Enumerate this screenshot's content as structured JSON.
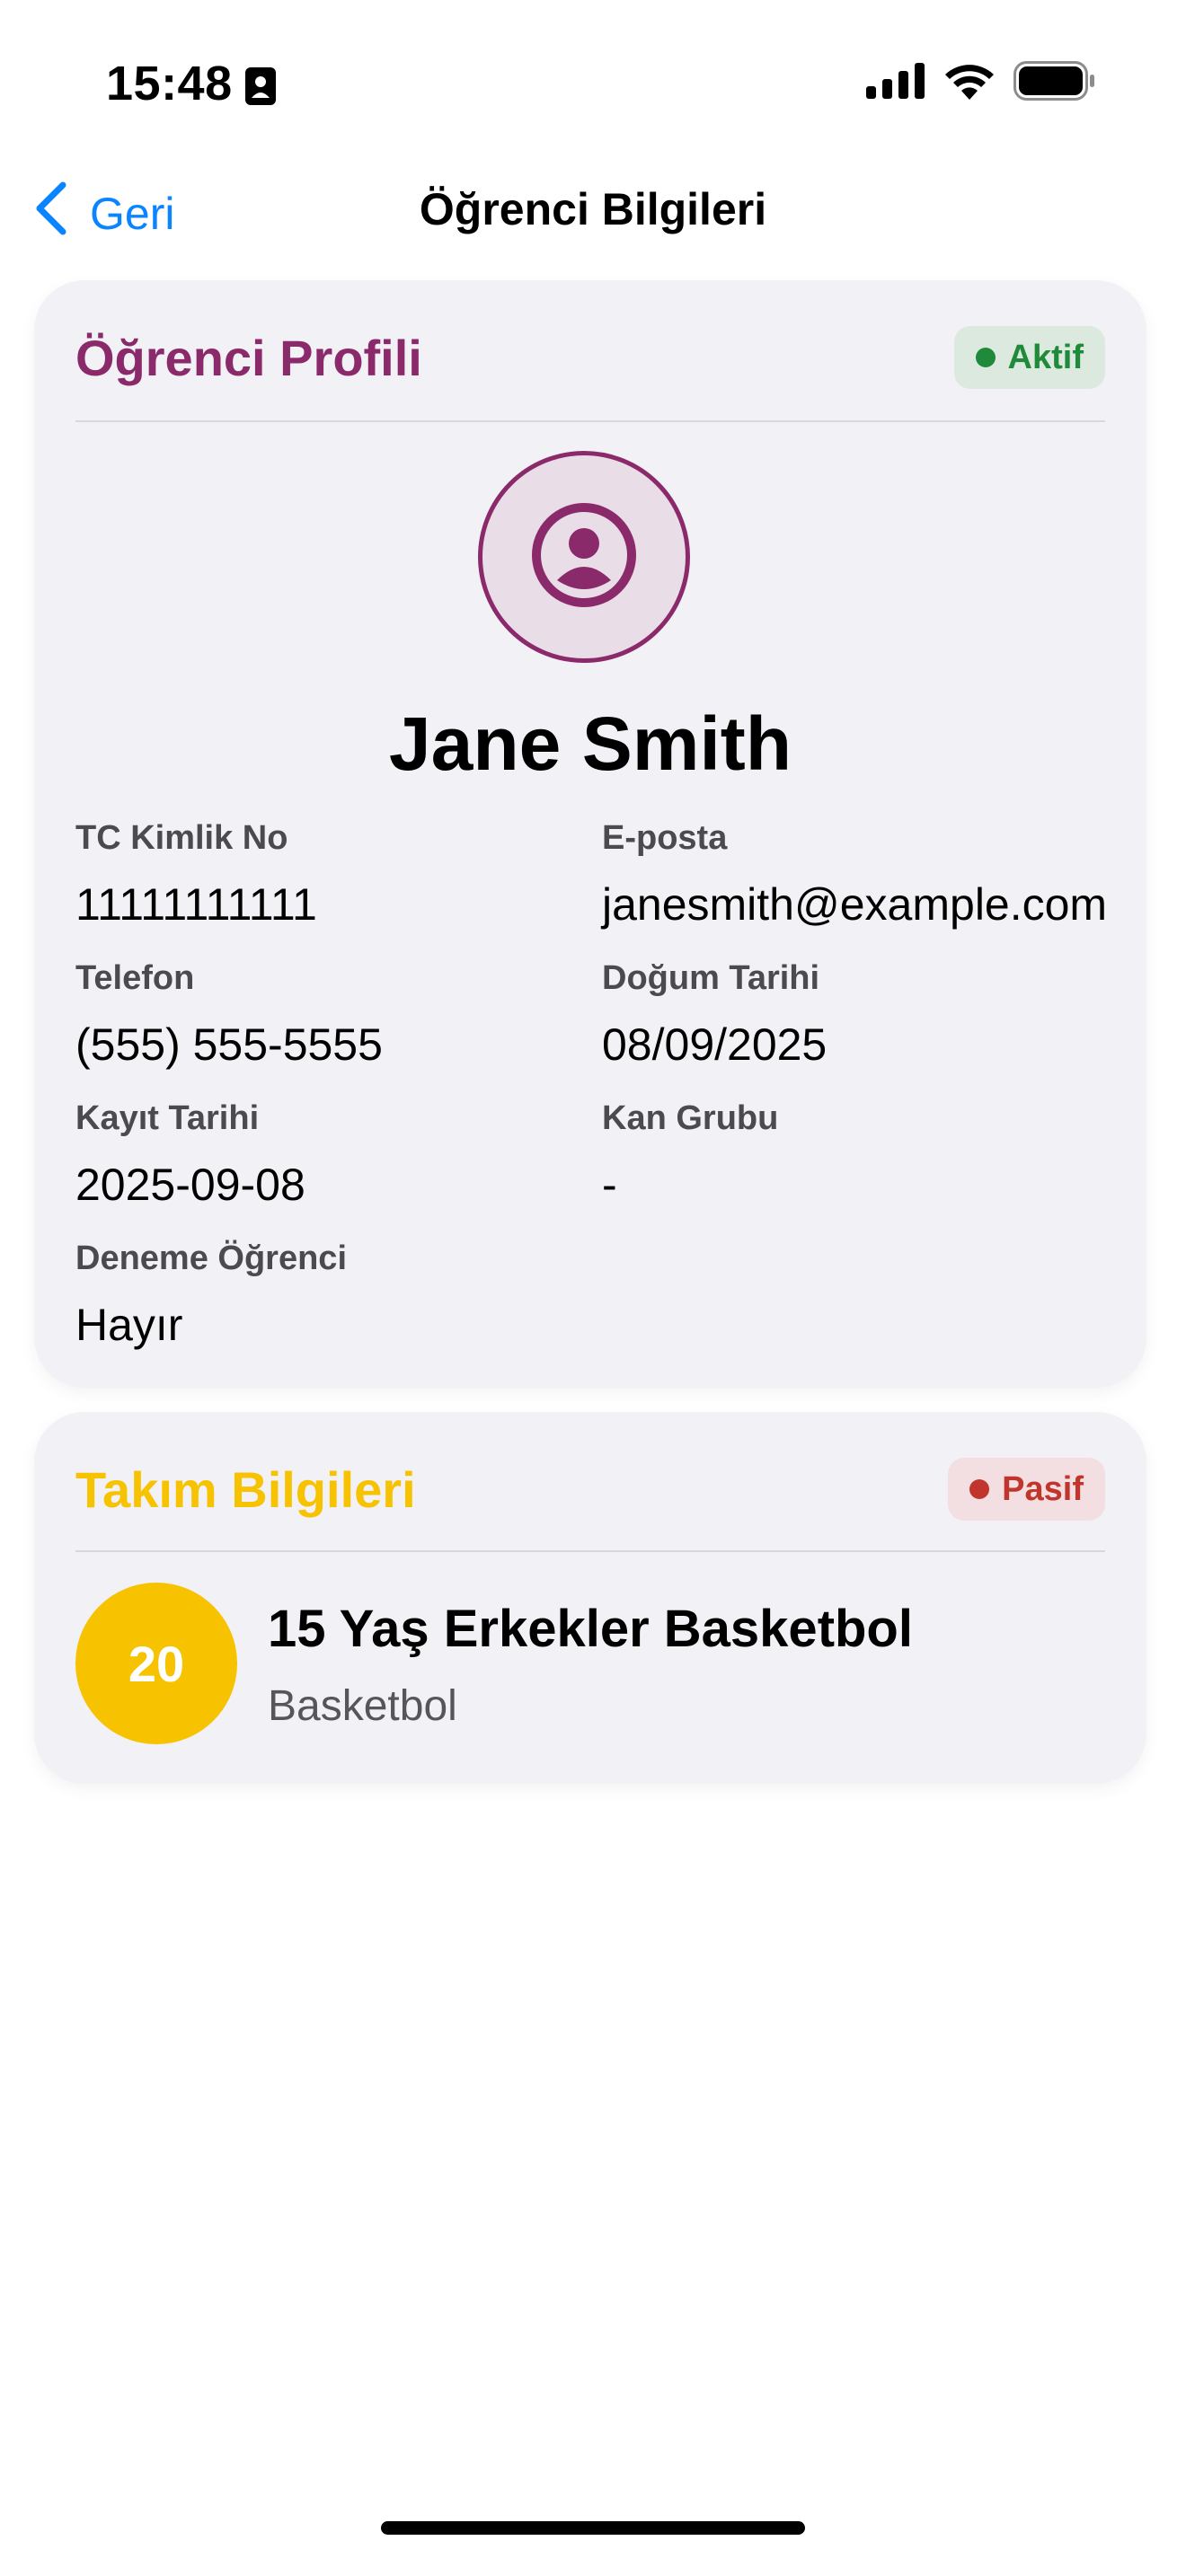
{
  "status_bar": {
    "time": "15:48",
    "sim_icon": "sim-card-icon",
    "signal_icon": "cellular-signal-icon",
    "wifi_icon": "wifi-icon",
    "battery_icon": "battery-icon"
  },
  "nav": {
    "back_label": "Geri",
    "back_icon": "chevron-left-icon",
    "title": "Öğrenci Bilgileri"
  },
  "profile_card": {
    "title": "Öğrenci Profili",
    "status_badge": "Aktif",
    "avatar_icon": "person-circle-icon",
    "name": "Jane Smith",
    "fields": [
      {
        "label": "TC Kimlik No",
        "value": "11111111111"
      },
      {
        "label": "E-posta",
        "value": "janesmith@example.com"
      },
      {
        "label": "Telefon",
        "value": "(555) 555-5555"
      },
      {
        "label": "Doğum Tarihi",
        "value": "08/09/2025"
      },
      {
        "label": "Kayıt Tarihi",
        "value": "2025-09-08"
      },
      {
        "label": "Kan Grubu",
        "value": "-"
      },
      {
        "label": "Deneme Öğrenci",
        "value": "Hayır"
      }
    ]
  },
  "team_card": {
    "title": "Takım Bilgileri",
    "status_badge": "Pasif",
    "team": {
      "number": "20",
      "name": "15 Yaş Erkekler Basketbol",
      "sport": "Basketbol"
    }
  },
  "colors": {
    "accent_blue": "#0a84ff",
    "profile_purple": "#8b2a6a",
    "team_yellow": "#f7c200",
    "active_green": "#1f8a3a",
    "active_bg": "#dbe9df",
    "passive_red": "#c0352c",
    "passive_bg": "#f3dfe1"
  }
}
